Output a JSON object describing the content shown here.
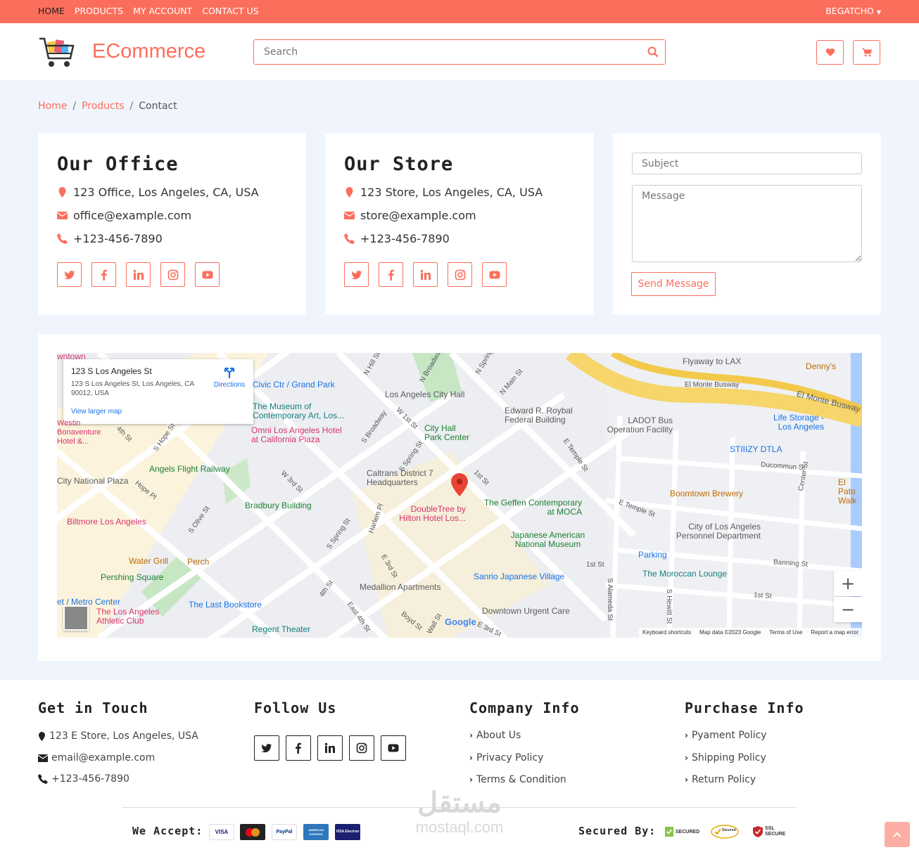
{
  "topbar": {
    "nav": [
      "HOME",
      "PRODUCTS",
      "MY ACCOUNT",
      "CONTACT US"
    ],
    "user": "BEGATCHO"
  },
  "header": {
    "brand": "ECommerce",
    "search_placeholder": "Search"
  },
  "breadcrumb": [
    "Home",
    "Products",
    "Contact"
  ],
  "office": {
    "title": "Our Office",
    "address": "123 Office, Los Angeles, CA, USA",
    "email": "office@example.com",
    "phone": "+123-456-7890"
  },
  "store": {
    "title": "Our Store",
    "address": "123 Store, Los Angeles, CA, USA",
    "email": "store@example.com",
    "phone": "+123-456-7890"
  },
  "contact_form": {
    "subject_placeholder": "Subject",
    "message_placeholder": "Message",
    "send_label": "Send Message"
  },
  "map": {
    "info_title": "123 S Los Angeles St",
    "info_address": "123 S Los Angeles St, Los Angeles, CA 90012, USA",
    "directions": "Directions",
    "view_larger": "View larger map",
    "labels": {
      "civic": "Civic Ctr / Grand Park",
      "city_hall": "Los Angeles City Hall",
      "roybal": "Edward R. Roybal Federal Building",
      "ladot": "LADOT Bus Operation Facility",
      "flyaway": "Flyaway to LAX",
      "dennys": "Denny's",
      "el_monte": "El Monte Busway",
      "life_storage": "Life Storage - Los Angeles",
      "stiizy": "STIIIZY DTLA",
      "moca": "The Museum of Contemporary Art, Los...",
      "omni": "Omni Los Angeles Hotel at California Plaza",
      "city_hall_park": "City Hall Park Center",
      "angels_flight": "Angels Flight Railway",
      "caltrans": "Caltrans District 7 Headquarters",
      "city_national": "City National Plaza",
      "bradbury": "Bradbury Building",
      "doubletree": "DoubleTree by Hilton Hotel Los...",
      "geffen": "The Geffen Contemporary at MOCA",
      "boomtown": "Boomtown Brewery",
      "biltmore": "Biltmore Los Angeles",
      "japanese_museum": "Japanese American National Museum",
      "lapd": "City of Los Angeles Personnel Department",
      "parking": "Parking",
      "water_grill": "Water Grill",
      "perch": "Perch",
      "sanrio": "Sanrio Japanese Village",
      "moroccan": "The Moroccan Lounge",
      "pershing": "Pershing Square",
      "medallion": "Medallion Apartments",
      "metro_center": "et / Metro Center",
      "last_bookstore": "The Last Bookstore",
      "athletic_club": "The Los Angeles Athletic Club",
      "urgent_care": "Downtown Urgent Care",
      "regent": "Regent Theater",
      "wntown": "wntown",
      "westin": "Westin Bonaventure Hotel &...",
      "el_pato": "El Pato Walk"
    },
    "streets": [
      "1st St",
      "E Temple St",
      "Ducommun St",
      "Banning St",
      "S Alameda St",
      "S Hewitt St",
      "Center St",
      "N Main St",
      "S Spring St",
      "S Broadway",
      "W 1st St",
      "W 3rd St",
      "4th St",
      "S Hope St",
      "Hope Pl",
      "S Olive St",
      "Harlem Pl",
      "E 3rd St",
      "East 4th St",
      "Boyd St",
      "Wall St",
      "E 3rd St",
      "N Hill St",
      "N Broadway",
      "N Spring St",
      "1st St"
    ],
    "footer": [
      "Keyboard shortcuts",
      "Map data ©2023 Google",
      "Terms of Use",
      "Report a map error"
    ],
    "google": "Google"
  },
  "footer": {
    "get_in_touch": {
      "title": "Get in Touch",
      "address": "123 E Store, Los Angeles, USA",
      "email": "email@example.com",
      "phone": "+123-456-7890"
    },
    "follow_us": {
      "title": "Follow Us"
    },
    "company_info": {
      "title": "Company Info",
      "links": [
        "About Us",
        "Privacy Policy",
        "Terms & Condition"
      ]
    },
    "purchase_info": {
      "title": "Purchase Info",
      "links": [
        "Pyament Policy",
        "Shipping Policy",
        "Return Policy"
      ]
    },
    "we_accept": "We Accept:",
    "secured_by": "Secured By:",
    "payments": [
      "VISA",
      "MasterCard",
      "PayPal",
      "AMERICAN EXPRESS",
      "VISA Electron"
    ],
    "security_badges": [
      "SECURED",
      "Secured",
      "SSL SECURE"
    ],
    "watermark_ar": "مستقل",
    "watermark_en": "mostaql.com"
  },
  "colors": {
    "accent": "#fc6e5c",
    "background": "#f0f4fd"
  }
}
